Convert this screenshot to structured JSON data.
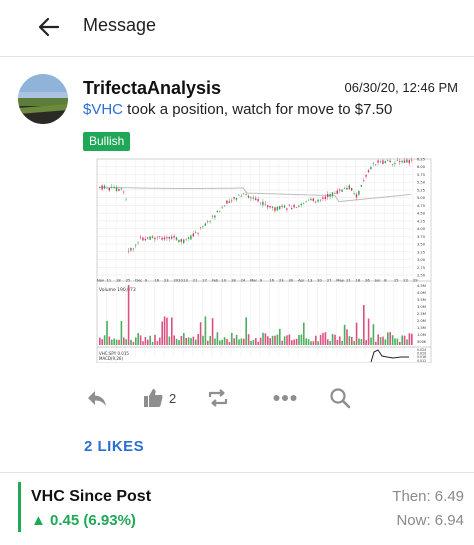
{
  "header": {
    "title": "Message"
  },
  "post": {
    "username": "TrifectaAnalysis",
    "timestamp": "06/30/20, 12:46 PM",
    "cashtag": "$VHC",
    "text": " took a position, watch for move to $7.50",
    "sentiment": "Bullish",
    "like_count": "2",
    "likes_link": "2 LIKES"
  },
  "colors": {
    "bullish": "#1fa857",
    "link": "#2b6fd6",
    "bear_candle": "#d6336c",
    "bull_candle": "#2ea043"
  },
  "chart_image": {
    "x_labels": [
      "Nov",
      "11",
      "18",
      "25",
      "Dec",
      "9",
      "16",
      "23",
      "2020",
      "13",
      "21",
      "27",
      "Feb",
      "10",
      "18",
      "24",
      "Mar",
      "9",
      "16",
      "23",
      "30",
      "Apr",
      "13",
      "20",
      "27",
      "May",
      "11",
      "18",
      "26",
      "Jun",
      "8",
      "15",
      "22",
      "29"
    ],
    "y_labels": [
      "6.25",
      "6.00",
      "5.75",
      "5.50",
      "5.25",
      "5.00",
      "4.75",
      "4.50",
      "4.25",
      "4.00",
      "3.75",
      "3.50",
      "3.25",
      "3.00",
      "2.75",
      "2.50"
    ],
    "volume_label": "Volume 190,073",
    "indicator_labels": [
      "VHC:SPY 0.015",
      "MACD(9,26)"
    ],
    "volume_ticks": [
      "4.5M",
      "4.0M",
      "3.5M",
      "3.0M",
      "2.5M",
      "2.0M",
      "1.5M",
      "1.0M",
      "500K"
    ],
    "indicator_ticks": [
      "0.024",
      "0.020",
      "0.016",
      "0.012"
    ]
  },
  "performance": {
    "title": "VHC Since Post",
    "change": "▲ 0.45 (6.93%)",
    "then": "Then: 6.49",
    "now": "Now: 6.94"
  }
}
